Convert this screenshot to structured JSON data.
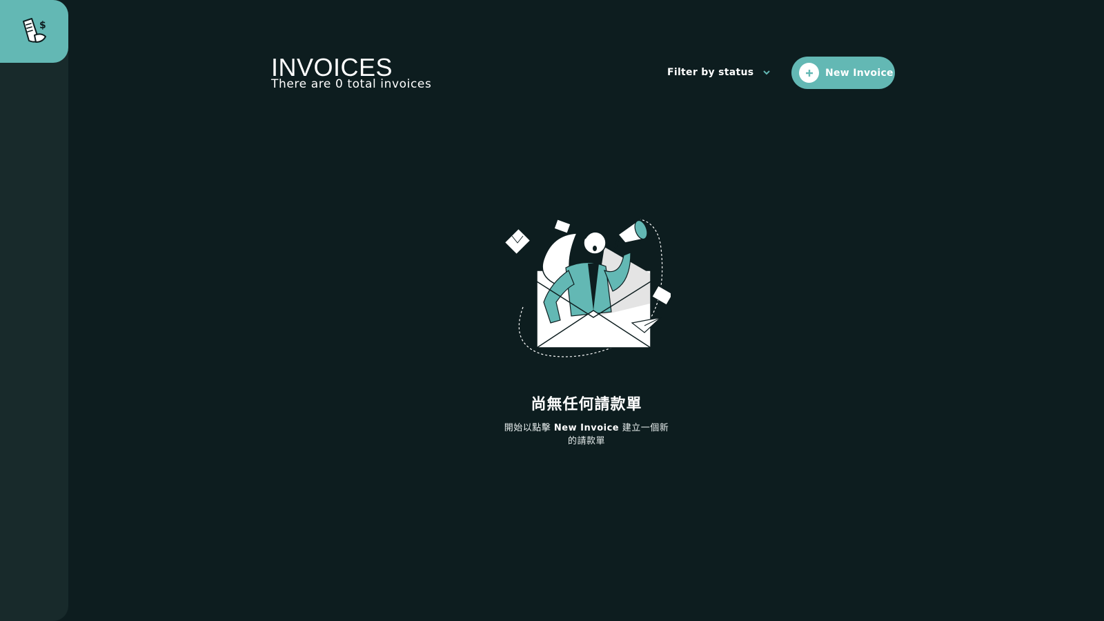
{
  "sidebar": {
    "logo_icon": "receipt-dollar-icon"
  },
  "header": {
    "title": "INVOICES",
    "subtitle": "There are 0 total invoices",
    "filter_label": "Filter by status",
    "filter_icon": "chevron-down-icon",
    "new_button_label": "New Invoice",
    "new_button_icon": "plus-icon"
  },
  "empty_state": {
    "illustration": "woman-megaphone-envelope-illustration",
    "title": "尚無任何請款單",
    "text_before": "開始以點擊 ",
    "text_highlight": "New Invoice",
    "text_after": " 建立一個新的請款單"
  },
  "colors": {
    "background": "#0d1d1f",
    "sidebar": "#182a2b",
    "accent": "#63b8b4",
    "text": "#ffffff"
  }
}
